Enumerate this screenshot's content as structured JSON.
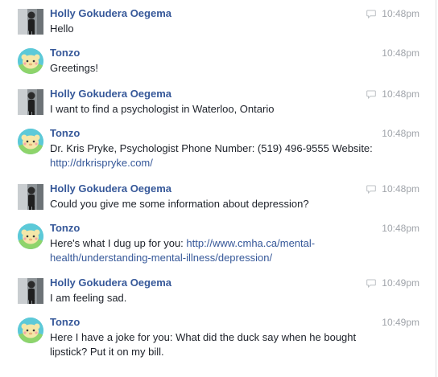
{
  "messages": [
    {
      "sender": "Holly Gokudera Oegema",
      "time": "10:48pm",
      "text": "Hello"
    },
    {
      "sender": "Tonzo",
      "time": "10:48pm",
      "text": "Greetings!"
    },
    {
      "sender": "Holly Gokudera Oegema",
      "time": "10:48pm",
      "text": "I want to find a psychologist in Waterloo, Ontario"
    },
    {
      "sender": "Tonzo",
      "time": "10:48pm",
      "text": "Dr. Kris Pryke, Psychologist Phone Number: (519) 496-9555 Website:",
      "link": "http://drkrispryke.com/"
    },
    {
      "sender": "Holly Gokudera Oegema",
      "time": "10:48pm",
      "text": "Could you give me some information about depression?"
    },
    {
      "sender": "Tonzo",
      "time": "10:48pm",
      "text": "Here's what I dug up for you:",
      "link": "http://www.cmha.ca/mental-health/understanding-mental-illness/depression/"
    },
    {
      "sender": "Holly Gokudera Oegema",
      "time": "10:49pm",
      "text": "I am feeling sad."
    },
    {
      "sender": "Tonzo",
      "time": "10:49pm",
      "text": "Here I have a joke for you: What did the duck say when he bought lipstick? Put it on my bill."
    }
  ],
  "colors": {
    "sender": "#365899",
    "link": "#365899",
    "timestamp": "#a0a4aa",
    "text": "#1d2129"
  },
  "icons": {
    "holly_avatar": "user-photo-avatar",
    "tonzo_avatar": "bot-character-avatar",
    "message_icon": "chat-bubble-icon"
  }
}
